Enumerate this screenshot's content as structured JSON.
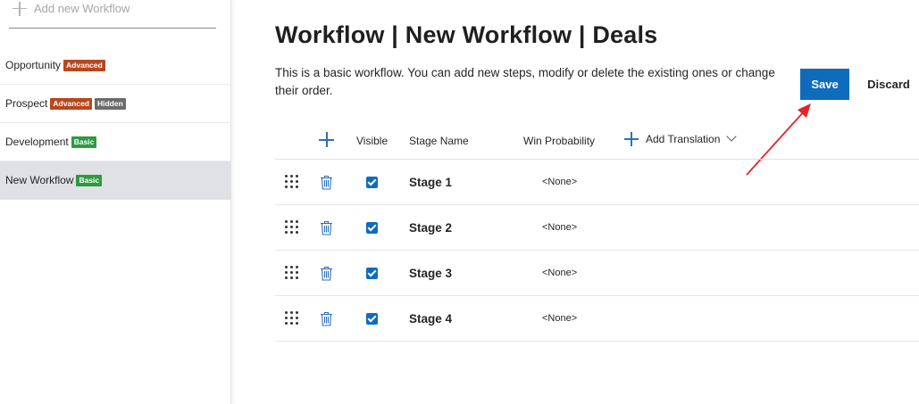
{
  "sidebar": {
    "add_label": "Add new Workflow",
    "items": [
      {
        "label": "Opportunity",
        "badges": [
          {
            "text": "Advanced",
            "kind": "advanced"
          }
        ],
        "selected": false
      },
      {
        "label": "Prospect",
        "badges": [
          {
            "text": "Advanced",
            "kind": "advanced"
          },
          {
            "text": "Hidden",
            "kind": "hidden"
          }
        ],
        "selected": false
      },
      {
        "label": "Development",
        "badges": [
          {
            "text": "Basic",
            "kind": "basic"
          }
        ],
        "selected": false
      },
      {
        "label": "New Workflow",
        "badges": [
          {
            "text": "Basic",
            "kind": "basic"
          }
        ],
        "selected": true
      }
    ]
  },
  "main": {
    "title": "Workflow | New Workflow | Deals",
    "description": "This is a basic workflow. You can add new steps, modify or delete the existing ones or change their order.",
    "save_label": "Save",
    "discard_label": "Discard"
  },
  "table": {
    "columns": {
      "visible": "Visible",
      "stage_name": "Stage Name",
      "win_probability": "Win Probability",
      "add_translation": "Add Translation"
    },
    "rows": [
      {
        "stage": "Stage 1",
        "probability": "<None>",
        "visible": true
      },
      {
        "stage": "Stage 2",
        "probability": "<None>",
        "visible": true
      },
      {
        "stage": "Stage 3",
        "probability": "<None>",
        "visible": true
      },
      {
        "stage": "Stage 4",
        "probability": "<None>",
        "visible": true
      }
    ]
  },
  "colors": {
    "accent": "#0f6cbd",
    "badge_advanced": "#b6471f",
    "badge_hidden": "#6b6b6b",
    "badge_basic": "#2e9a41",
    "annotation_arrow": "#e0262b"
  },
  "icons": {
    "add": "plus-icon",
    "drag": "drag-handle-icon",
    "delete": "trash-icon",
    "dropdown": "chevron-down-icon"
  }
}
